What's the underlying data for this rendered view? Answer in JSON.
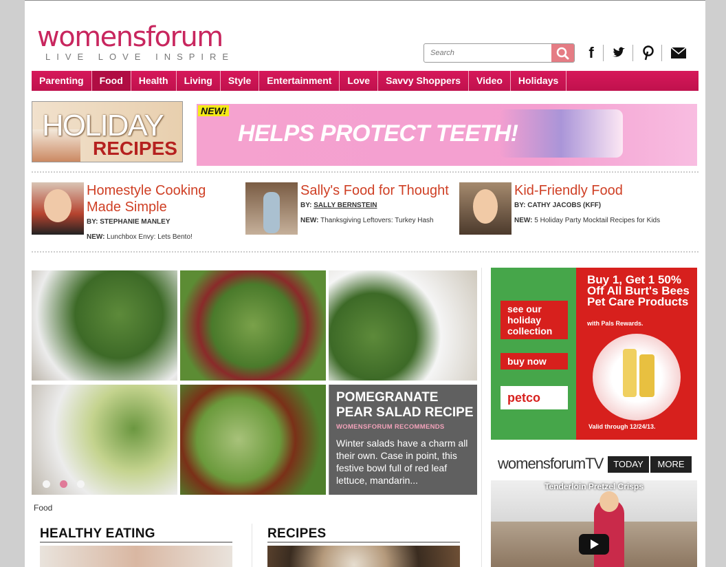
{
  "site": {
    "logo_word": "womensforum",
    "tagline": "LIVE LOVE INSPIRE"
  },
  "search": {
    "placeholder": "Search"
  },
  "nav": [
    {
      "label": "Parenting"
    },
    {
      "label": "Food"
    },
    {
      "label": "Health"
    },
    {
      "label": "Living"
    },
    {
      "label": "Style"
    },
    {
      "label": "Entertainment"
    },
    {
      "label": "Love"
    },
    {
      "label": "Savvy Shoppers"
    },
    {
      "label": "Video"
    },
    {
      "label": "Holidays"
    }
  ],
  "nav_active": "Food",
  "holiday_banner": {
    "line1": "HOLIDAY",
    "line2": "RECIPES"
  },
  "ad_top": {
    "badge": "NEW!",
    "text": "HELPS PROTECT TEETH!"
  },
  "columnists": [
    {
      "title": "Homestyle Cooking Made Simple",
      "by_label": "BY:",
      "author": "STEPHANIE MANLEY",
      "new_label": "NEW:",
      "new_text": "Lunchbox Envy: Lets Bento!"
    },
    {
      "title": "Sally's Food for Thought",
      "by_label": "BY:",
      "author": "SALLY BERNSTEIN",
      "new_label": "NEW:",
      "new_text": "Thanksgiving Leftovers: Turkey Hash"
    },
    {
      "title": "Kid-Friendly Food",
      "by_label": "BY:",
      "author": "CATHY JACOBS (KFF)",
      "new_label": "NEW:",
      "new_text": "5 Holiday Party Mocktail Recipes for Kids"
    }
  ],
  "slider": {
    "title": "POMEGRANATE PEAR SALAD RECIPE",
    "subtitle": "WOMENSFORUM RECOMMENDS",
    "description": "Winter salads have a charm all their own. Case in point, this festive bowl full of red leaf lettuce, mandarin...",
    "active_dot": 2,
    "dot_count": 3
  },
  "category_label": "Food",
  "sections": [
    {
      "title": "HEALTHY EATING"
    },
    {
      "title": "RECIPES"
    }
  ],
  "ad_right": {
    "btn_collection": "see our holiday collection",
    "btn_buy": "buy now",
    "logo": "petco",
    "offer_title": "Buy 1, Get 1 50% Off All Burt's Bees Pet Care Products",
    "offer_sub": "with Pals Rewards.",
    "valid": "Valid through 12/24/13."
  },
  "tv": {
    "logo": "womensforumTV",
    "tab_today": "TODAY",
    "tab_more": "MORE",
    "video_title": "Tenderloin Pretzel Crisps"
  },
  "colors": {
    "brand": "#c8265e",
    "nav": "#d6185a",
    "headline": "#cf3f24",
    "ad_pink": "#f5a2cf",
    "petco_red": "#d7201d",
    "petco_green": "#46a64a"
  }
}
